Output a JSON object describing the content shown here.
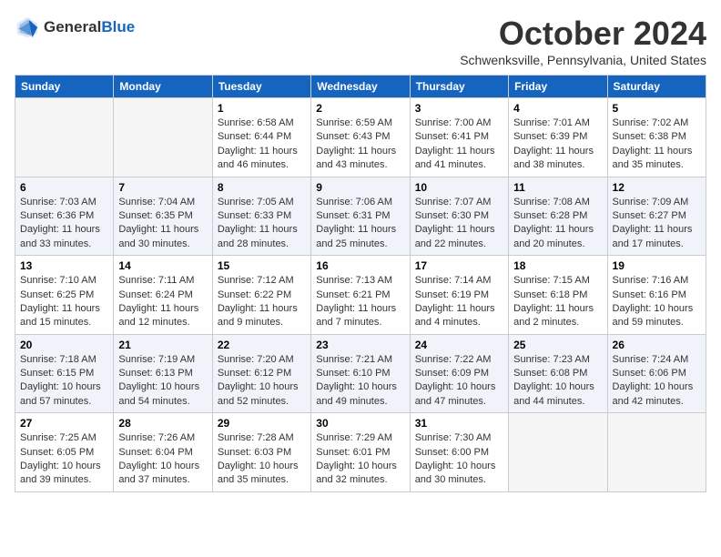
{
  "header": {
    "logo": {
      "general": "General",
      "blue": "Blue"
    },
    "month": "October 2024",
    "location": "Schwenksville, Pennsylvania, United States"
  },
  "weekdays": [
    "Sunday",
    "Monday",
    "Tuesday",
    "Wednesday",
    "Thursday",
    "Friday",
    "Saturday"
  ],
  "weeks": [
    [
      {
        "day": "",
        "empty": true
      },
      {
        "day": "",
        "empty": true
      },
      {
        "day": "1",
        "sunrise": "Sunrise: 6:58 AM",
        "sunset": "Sunset: 6:44 PM",
        "daylight": "Daylight: 11 hours and 46 minutes."
      },
      {
        "day": "2",
        "sunrise": "Sunrise: 6:59 AM",
        "sunset": "Sunset: 6:43 PM",
        "daylight": "Daylight: 11 hours and 43 minutes."
      },
      {
        "day": "3",
        "sunrise": "Sunrise: 7:00 AM",
        "sunset": "Sunset: 6:41 PM",
        "daylight": "Daylight: 11 hours and 41 minutes."
      },
      {
        "day": "4",
        "sunrise": "Sunrise: 7:01 AM",
        "sunset": "Sunset: 6:39 PM",
        "daylight": "Daylight: 11 hours and 38 minutes."
      },
      {
        "day": "5",
        "sunrise": "Sunrise: 7:02 AM",
        "sunset": "Sunset: 6:38 PM",
        "daylight": "Daylight: 11 hours and 35 minutes."
      }
    ],
    [
      {
        "day": "6",
        "sunrise": "Sunrise: 7:03 AM",
        "sunset": "Sunset: 6:36 PM",
        "daylight": "Daylight: 11 hours and 33 minutes."
      },
      {
        "day": "7",
        "sunrise": "Sunrise: 7:04 AM",
        "sunset": "Sunset: 6:35 PM",
        "daylight": "Daylight: 11 hours and 30 minutes."
      },
      {
        "day": "8",
        "sunrise": "Sunrise: 7:05 AM",
        "sunset": "Sunset: 6:33 PM",
        "daylight": "Daylight: 11 hours and 28 minutes."
      },
      {
        "day": "9",
        "sunrise": "Sunrise: 7:06 AM",
        "sunset": "Sunset: 6:31 PM",
        "daylight": "Daylight: 11 hours and 25 minutes."
      },
      {
        "day": "10",
        "sunrise": "Sunrise: 7:07 AM",
        "sunset": "Sunset: 6:30 PM",
        "daylight": "Daylight: 11 hours and 22 minutes."
      },
      {
        "day": "11",
        "sunrise": "Sunrise: 7:08 AM",
        "sunset": "Sunset: 6:28 PM",
        "daylight": "Daylight: 11 hours and 20 minutes."
      },
      {
        "day": "12",
        "sunrise": "Sunrise: 7:09 AM",
        "sunset": "Sunset: 6:27 PM",
        "daylight": "Daylight: 11 hours and 17 minutes."
      }
    ],
    [
      {
        "day": "13",
        "sunrise": "Sunrise: 7:10 AM",
        "sunset": "Sunset: 6:25 PM",
        "daylight": "Daylight: 11 hours and 15 minutes."
      },
      {
        "day": "14",
        "sunrise": "Sunrise: 7:11 AM",
        "sunset": "Sunset: 6:24 PM",
        "daylight": "Daylight: 11 hours and 12 minutes."
      },
      {
        "day": "15",
        "sunrise": "Sunrise: 7:12 AM",
        "sunset": "Sunset: 6:22 PM",
        "daylight": "Daylight: 11 hours and 9 minutes."
      },
      {
        "day": "16",
        "sunrise": "Sunrise: 7:13 AM",
        "sunset": "Sunset: 6:21 PM",
        "daylight": "Daylight: 11 hours and 7 minutes."
      },
      {
        "day": "17",
        "sunrise": "Sunrise: 7:14 AM",
        "sunset": "Sunset: 6:19 PM",
        "daylight": "Daylight: 11 hours and 4 minutes."
      },
      {
        "day": "18",
        "sunrise": "Sunrise: 7:15 AM",
        "sunset": "Sunset: 6:18 PM",
        "daylight": "Daylight: 11 hours and 2 minutes."
      },
      {
        "day": "19",
        "sunrise": "Sunrise: 7:16 AM",
        "sunset": "Sunset: 6:16 PM",
        "daylight": "Daylight: 10 hours and 59 minutes."
      }
    ],
    [
      {
        "day": "20",
        "sunrise": "Sunrise: 7:18 AM",
        "sunset": "Sunset: 6:15 PM",
        "daylight": "Daylight: 10 hours and 57 minutes."
      },
      {
        "day": "21",
        "sunrise": "Sunrise: 7:19 AM",
        "sunset": "Sunset: 6:13 PM",
        "daylight": "Daylight: 10 hours and 54 minutes."
      },
      {
        "day": "22",
        "sunrise": "Sunrise: 7:20 AM",
        "sunset": "Sunset: 6:12 PM",
        "daylight": "Daylight: 10 hours and 52 minutes."
      },
      {
        "day": "23",
        "sunrise": "Sunrise: 7:21 AM",
        "sunset": "Sunset: 6:10 PM",
        "daylight": "Daylight: 10 hours and 49 minutes."
      },
      {
        "day": "24",
        "sunrise": "Sunrise: 7:22 AM",
        "sunset": "Sunset: 6:09 PM",
        "daylight": "Daylight: 10 hours and 47 minutes."
      },
      {
        "day": "25",
        "sunrise": "Sunrise: 7:23 AM",
        "sunset": "Sunset: 6:08 PM",
        "daylight": "Daylight: 10 hours and 44 minutes."
      },
      {
        "day": "26",
        "sunrise": "Sunrise: 7:24 AM",
        "sunset": "Sunset: 6:06 PM",
        "daylight": "Daylight: 10 hours and 42 minutes."
      }
    ],
    [
      {
        "day": "27",
        "sunrise": "Sunrise: 7:25 AM",
        "sunset": "Sunset: 6:05 PM",
        "daylight": "Daylight: 10 hours and 39 minutes."
      },
      {
        "day": "28",
        "sunrise": "Sunrise: 7:26 AM",
        "sunset": "Sunset: 6:04 PM",
        "daylight": "Daylight: 10 hours and 37 minutes."
      },
      {
        "day": "29",
        "sunrise": "Sunrise: 7:28 AM",
        "sunset": "Sunset: 6:03 PM",
        "daylight": "Daylight: 10 hours and 35 minutes."
      },
      {
        "day": "30",
        "sunrise": "Sunrise: 7:29 AM",
        "sunset": "Sunset: 6:01 PM",
        "daylight": "Daylight: 10 hours and 32 minutes."
      },
      {
        "day": "31",
        "sunrise": "Sunrise: 7:30 AM",
        "sunset": "Sunset: 6:00 PM",
        "daylight": "Daylight: 10 hours and 30 minutes."
      },
      {
        "day": "",
        "empty": true
      },
      {
        "day": "",
        "empty": true
      }
    ]
  ]
}
